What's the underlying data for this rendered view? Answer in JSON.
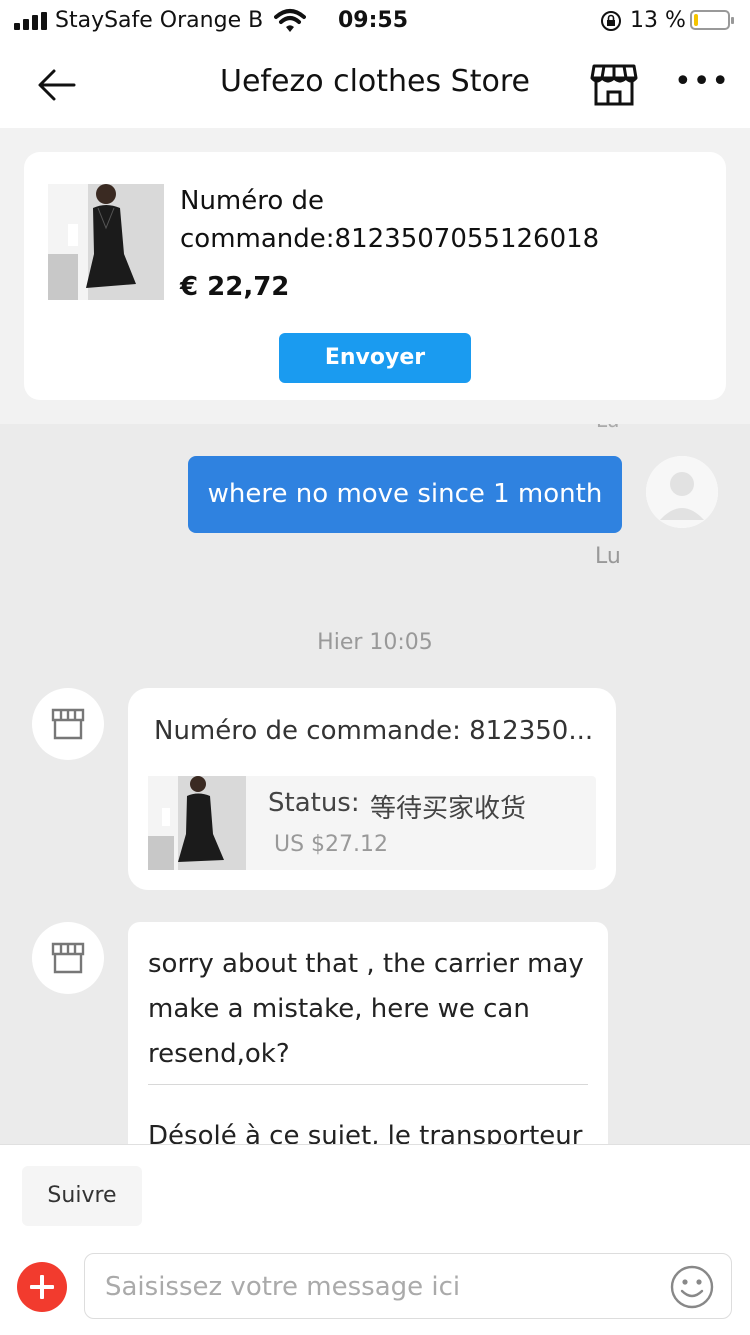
{
  "status_bar": {
    "carrier": "StaySafe Orange B",
    "time": "09:55",
    "battery_percent": "13 %",
    "battery_level": 0.13
  },
  "nav": {
    "title": "Uefezo clothes Store",
    "back_icon": "arrow-left-icon",
    "store_icon": "storefront-icon",
    "more_icon": "more-dots-icon",
    "more_glyph": "•••"
  },
  "order_card": {
    "order_number": "Numéro de commande:8123507055126018",
    "price": "€ 22,72",
    "send_label": "Envoyer"
  },
  "chat": {
    "peek_text": "Lu",
    "messages": [
      {
        "type": "outgoing",
        "text": "where no move since 1 month",
        "read_label": "Lu"
      }
    ],
    "date_separator": "Hier 10:05",
    "order_message": {
      "title": "Numéro de commande: 812350...",
      "status_label": "Status:",
      "status_value": "等待买家收货",
      "price": "US $27.12"
    },
    "reply": {
      "text_en": "sorry about that , the carrier may make a mistake, here we can resend,ok?",
      "text_fr": "Désolé à ce sujet, le transporteur"
    }
  },
  "footer": {
    "follow_label": "Suivre",
    "input_placeholder": "Saisissez votre message ici",
    "input_value": "",
    "plus_icon": "add-circle-icon",
    "emoji_icon": "smiley-icon"
  },
  "colors": {
    "accent_blue": "#1a9bf0",
    "outgoing_bubble": "#2f82e0",
    "plus_red": "#f23b2e",
    "chat_background": "#ebebeb"
  }
}
